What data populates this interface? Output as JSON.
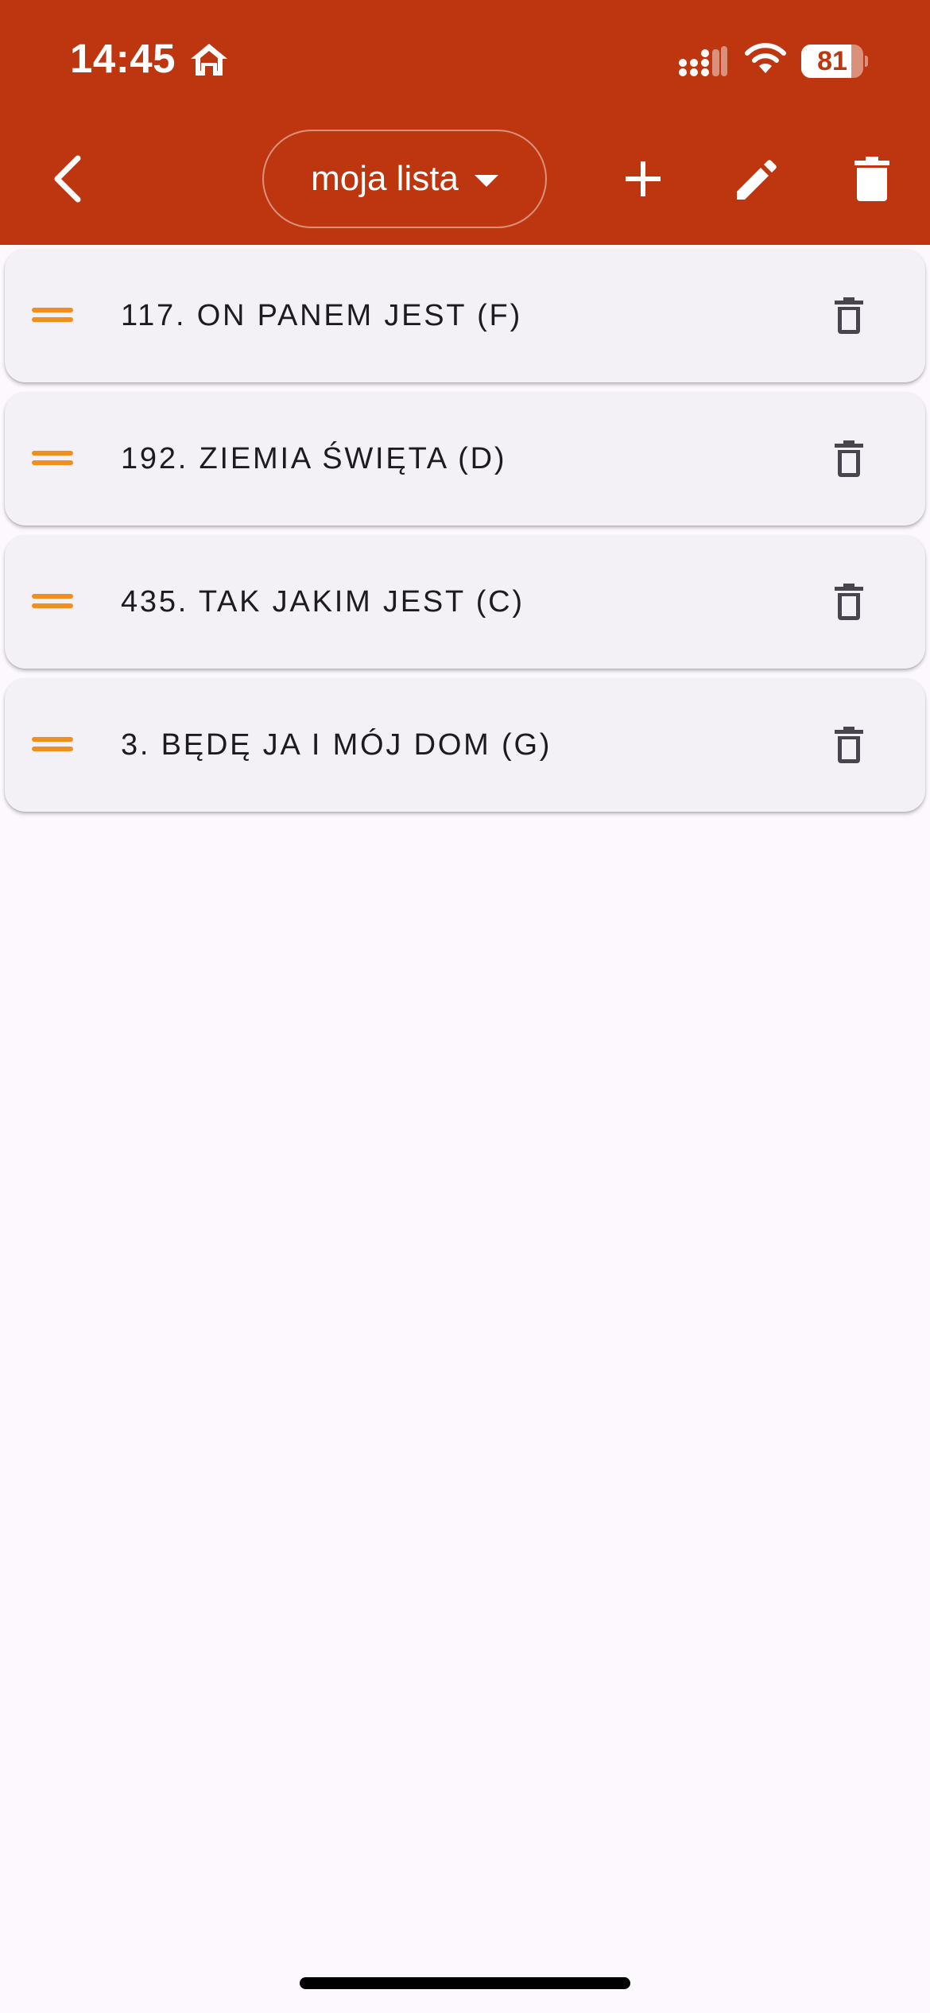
{
  "status_bar": {
    "time": "14:45",
    "battery_level": "81",
    "battery_fraction": 0.81,
    "icons": [
      "home-icon",
      "cellular-signal-icon",
      "wifi-icon",
      "battery-icon"
    ]
  },
  "app_bar": {
    "background_color": "#be360f",
    "selected_list": "moja lista",
    "icons": {
      "back": "chevron-left-icon",
      "dropdown": "caret-down-icon",
      "add": "plus-icon",
      "edit": "pencil-icon",
      "delete": "trash-filled-icon"
    }
  },
  "songs": [
    {
      "title": "117. ON PANEM JEST (F)"
    },
    {
      "title": "192. ZIEMIA ŚWIĘTA (D)"
    },
    {
      "title": "435. TAK JAKIM JEST (C)"
    },
    {
      "title": "3. BĘDĘ JA I MÓJ DOM (G)"
    }
  ],
  "item_icons": {
    "drag": "drag-handle-icon",
    "delete": "trash-outline-icon"
  },
  "colors": {
    "accent_orange": "#f18e21",
    "page_background": "#fcf8fd",
    "card_background": "#f4f1f6",
    "text": "#1d1b20"
  }
}
